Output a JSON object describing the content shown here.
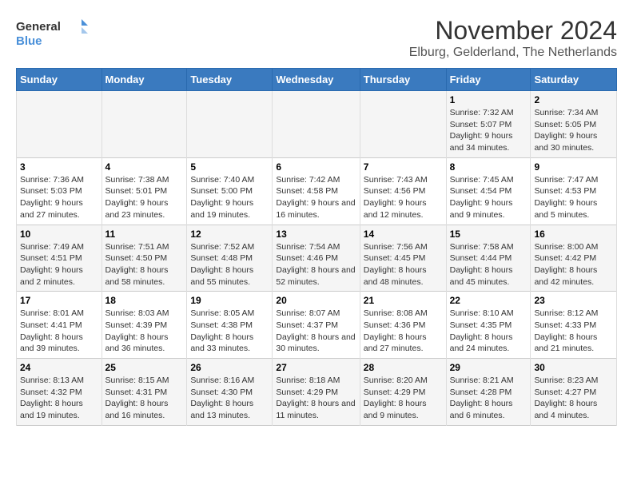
{
  "logo": {
    "line1": "General",
    "line2": "Blue"
  },
  "title": "November 2024",
  "location": "Elburg, Gelderland, The Netherlands",
  "days_of_week": [
    "Sunday",
    "Monday",
    "Tuesday",
    "Wednesday",
    "Thursday",
    "Friday",
    "Saturday"
  ],
  "weeks": [
    [
      {
        "day": "",
        "info": ""
      },
      {
        "day": "",
        "info": ""
      },
      {
        "day": "",
        "info": ""
      },
      {
        "day": "",
        "info": ""
      },
      {
        "day": "",
        "info": ""
      },
      {
        "day": "1",
        "info": "Sunrise: 7:32 AM\nSunset: 5:07 PM\nDaylight: 9 hours and 34 minutes."
      },
      {
        "day": "2",
        "info": "Sunrise: 7:34 AM\nSunset: 5:05 PM\nDaylight: 9 hours and 30 minutes."
      }
    ],
    [
      {
        "day": "3",
        "info": "Sunrise: 7:36 AM\nSunset: 5:03 PM\nDaylight: 9 hours and 27 minutes."
      },
      {
        "day": "4",
        "info": "Sunrise: 7:38 AM\nSunset: 5:01 PM\nDaylight: 9 hours and 23 minutes."
      },
      {
        "day": "5",
        "info": "Sunrise: 7:40 AM\nSunset: 5:00 PM\nDaylight: 9 hours and 19 minutes."
      },
      {
        "day": "6",
        "info": "Sunrise: 7:42 AM\nSunset: 4:58 PM\nDaylight: 9 hours and 16 minutes."
      },
      {
        "day": "7",
        "info": "Sunrise: 7:43 AM\nSunset: 4:56 PM\nDaylight: 9 hours and 12 minutes."
      },
      {
        "day": "8",
        "info": "Sunrise: 7:45 AM\nSunset: 4:54 PM\nDaylight: 9 hours and 9 minutes."
      },
      {
        "day": "9",
        "info": "Sunrise: 7:47 AM\nSunset: 4:53 PM\nDaylight: 9 hours and 5 minutes."
      }
    ],
    [
      {
        "day": "10",
        "info": "Sunrise: 7:49 AM\nSunset: 4:51 PM\nDaylight: 9 hours and 2 minutes."
      },
      {
        "day": "11",
        "info": "Sunrise: 7:51 AM\nSunset: 4:50 PM\nDaylight: 8 hours and 58 minutes."
      },
      {
        "day": "12",
        "info": "Sunrise: 7:52 AM\nSunset: 4:48 PM\nDaylight: 8 hours and 55 minutes."
      },
      {
        "day": "13",
        "info": "Sunrise: 7:54 AM\nSunset: 4:46 PM\nDaylight: 8 hours and 52 minutes."
      },
      {
        "day": "14",
        "info": "Sunrise: 7:56 AM\nSunset: 4:45 PM\nDaylight: 8 hours and 48 minutes."
      },
      {
        "day": "15",
        "info": "Sunrise: 7:58 AM\nSunset: 4:44 PM\nDaylight: 8 hours and 45 minutes."
      },
      {
        "day": "16",
        "info": "Sunrise: 8:00 AM\nSunset: 4:42 PM\nDaylight: 8 hours and 42 minutes."
      }
    ],
    [
      {
        "day": "17",
        "info": "Sunrise: 8:01 AM\nSunset: 4:41 PM\nDaylight: 8 hours and 39 minutes."
      },
      {
        "day": "18",
        "info": "Sunrise: 8:03 AM\nSunset: 4:39 PM\nDaylight: 8 hours and 36 minutes."
      },
      {
        "day": "19",
        "info": "Sunrise: 8:05 AM\nSunset: 4:38 PM\nDaylight: 8 hours and 33 minutes."
      },
      {
        "day": "20",
        "info": "Sunrise: 8:07 AM\nSunset: 4:37 PM\nDaylight: 8 hours and 30 minutes."
      },
      {
        "day": "21",
        "info": "Sunrise: 8:08 AM\nSunset: 4:36 PM\nDaylight: 8 hours and 27 minutes."
      },
      {
        "day": "22",
        "info": "Sunrise: 8:10 AM\nSunset: 4:35 PM\nDaylight: 8 hours and 24 minutes."
      },
      {
        "day": "23",
        "info": "Sunrise: 8:12 AM\nSunset: 4:33 PM\nDaylight: 8 hours and 21 minutes."
      }
    ],
    [
      {
        "day": "24",
        "info": "Sunrise: 8:13 AM\nSunset: 4:32 PM\nDaylight: 8 hours and 19 minutes."
      },
      {
        "day": "25",
        "info": "Sunrise: 8:15 AM\nSunset: 4:31 PM\nDaylight: 8 hours and 16 minutes."
      },
      {
        "day": "26",
        "info": "Sunrise: 8:16 AM\nSunset: 4:30 PM\nDaylight: 8 hours and 13 minutes."
      },
      {
        "day": "27",
        "info": "Sunrise: 8:18 AM\nSunset: 4:29 PM\nDaylight: 8 hours and 11 minutes."
      },
      {
        "day": "28",
        "info": "Sunrise: 8:20 AM\nSunset: 4:29 PM\nDaylight: 8 hours and 9 minutes."
      },
      {
        "day": "29",
        "info": "Sunrise: 8:21 AM\nSunset: 4:28 PM\nDaylight: 8 hours and 6 minutes."
      },
      {
        "day": "30",
        "info": "Sunrise: 8:23 AM\nSunset: 4:27 PM\nDaylight: 8 hours and 4 minutes."
      }
    ]
  ]
}
